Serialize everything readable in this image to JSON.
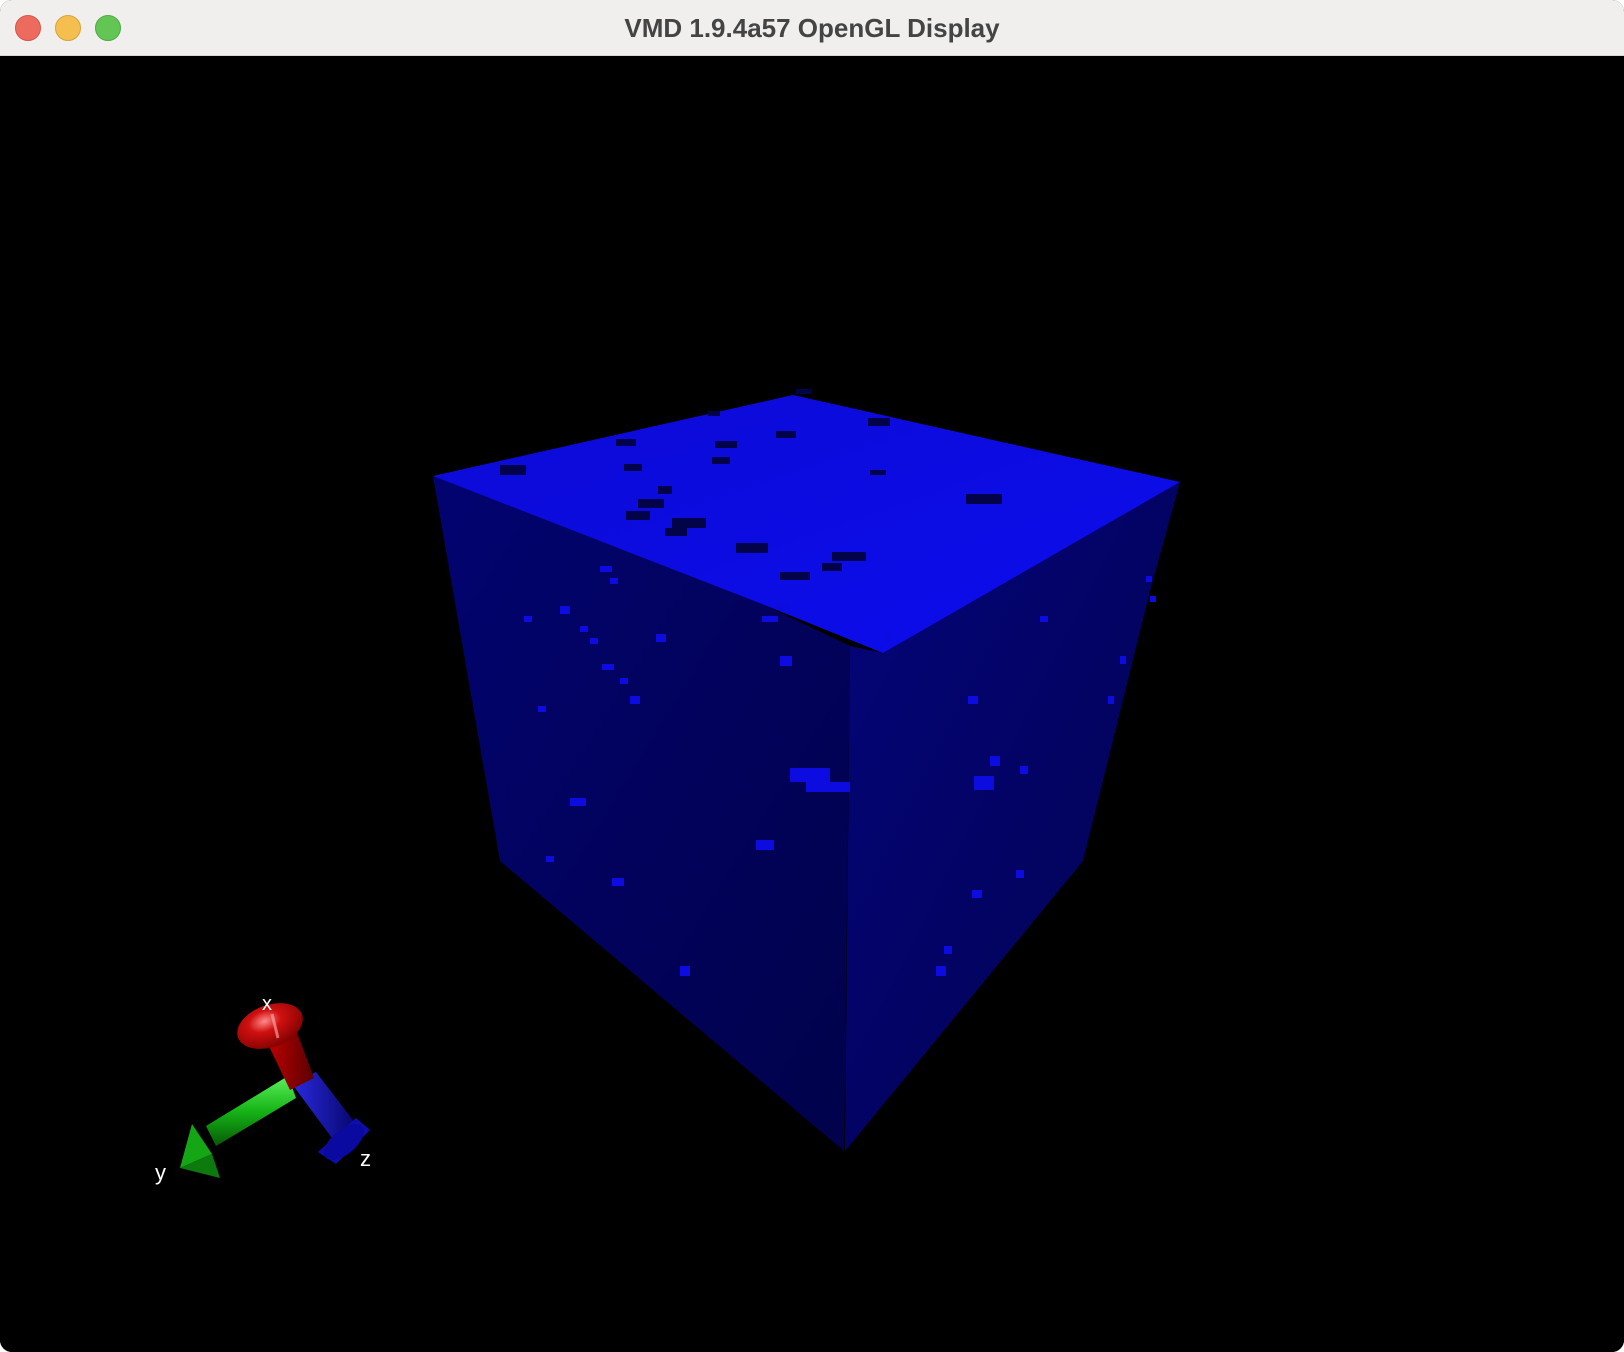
{
  "window": {
    "title": "VMD 1.9.4a57 OpenGL Display"
  },
  "traffic_lights": {
    "close": "close-button",
    "minimize": "minimize-button",
    "zoom": "zoom-button"
  },
  "colors": {
    "background": "#000000",
    "cube_top": "#0c0ae0",
    "cube_left": "#02025e",
    "cube_right": "#030364",
    "axis_x": "#c40000",
    "axis_y": "#10b010",
    "axis_z": "#1010c0",
    "axis_label": "#ffffff"
  },
  "axes": {
    "x_label": "x",
    "y_label": "y",
    "z_label": "z"
  }
}
